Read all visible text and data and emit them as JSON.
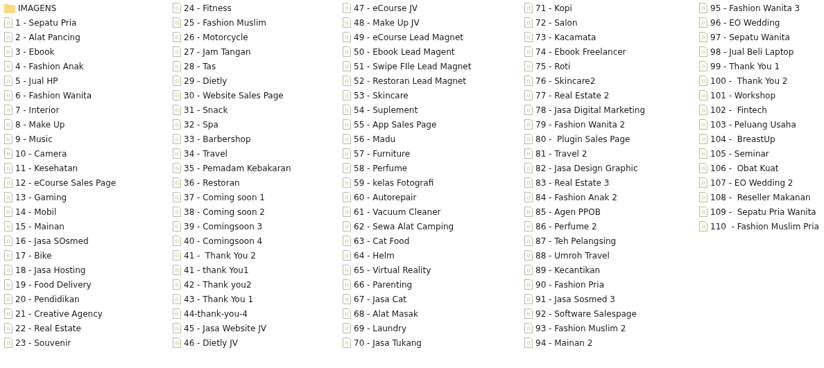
{
  "items": [
    {
      "kind": "folder",
      "name": "IMAGENS"
    },
    {
      "kind": "file",
      "name": "1 - Sepatu Pria"
    },
    {
      "kind": "file",
      "name": "2 - Alat Pancing"
    },
    {
      "kind": "file",
      "name": "3 - Ebook"
    },
    {
      "kind": "file",
      "name": "4 - Fashion Anak"
    },
    {
      "kind": "file",
      "name": "5 - Jual HP"
    },
    {
      "kind": "file",
      "name": "6 - Fashion Wanita"
    },
    {
      "kind": "file",
      "name": "7 - Interior"
    },
    {
      "kind": "file",
      "name": "8 - Make Up"
    },
    {
      "kind": "file",
      "name": "9 - Music"
    },
    {
      "kind": "file",
      "name": "10 - Camera"
    },
    {
      "kind": "file",
      "name": "11 - Kesehatan"
    },
    {
      "kind": "file",
      "name": "12 - eCourse Sales Page"
    },
    {
      "kind": "file",
      "name": "13 - Gaming"
    },
    {
      "kind": "file",
      "name": "14 - Mobil"
    },
    {
      "kind": "file",
      "name": "15 - Mainan"
    },
    {
      "kind": "file",
      "name": "16 - Jasa SOsmed"
    },
    {
      "kind": "file",
      "name": "17 - Bike"
    },
    {
      "kind": "file",
      "name": "18 - Jasa Hosting"
    },
    {
      "kind": "file",
      "name": "19 - Food Delivery"
    },
    {
      "kind": "file",
      "name": "20 - Pendidikan"
    },
    {
      "kind": "file",
      "name": "21 - Creative Agency"
    },
    {
      "kind": "file",
      "name": "22 - Real Estate"
    },
    {
      "kind": "file",
      "name": "23 - Souvenir"
    },
    {
      "kind": "file",
      "name": "24 - Fitness"
    },
    {
      "kind": "file",
      "name": "25 - Fashion Muslim"
    },
    {
      "kind": "file",
      "name": "26 - Motorcycle"
    },
    {
      "kind": "file",
      "name": "27 - Jam Tangan"
    },
    {
      "kind": "file",
      "name": "28 - Tas"
    },
    {
      "kind": "file",
      "name": "29 - Dietly"
    },
    {
      "kind": "file",
      "name": "30 - Website Sales Page"
    },
    {
      "kind": "file",
      "name": "31 - Snack"
    },
    {
      "kind": "file",
      "name": "32 - Spa"
    },
    {
      "kind": "file",
      "name": "33 - Barbershop"
    },
    {
      "kind": "file",
      "name": "34 - Travel"
    },
    {
      "kind": "file",
      "name": "35 - Pemadam Kebakaran"
    },
    {
      "kind": "file",
      "name": "36 - Restoran"
    },
    {
      "kind": "file",
      "name": "37 - Coming soon 1"
    },
    {
      "kind": "file",
      "name": "38 - Coming soon 2"
    },
    {
      "kind": "file",
      "name": "39 - Comingsoon 3"
    },
    {
      "kind": "file",
      "name": "40 - Comingsoon 4"
    },
    {
      "kind": "file",
      "name": "41 -  Thank You 2"
    },
    {
      "kind": "file",
      "name": "41 - thank You1"
    },
    {
      "kind": "file",
      "name": "42 - Thank you2"
    },
    {
      "kind": "file",
      "name": "43 - Thank You 1"
    },
    {
      "kind": "file",
      "name": "44-thank-you-4"
    },
    {
      "kind": "file",
      "name": "45 - Jasa Website JV"
    },
    {
      "kind": "file",
      "name": "46 - Dietly JV"
    },
    {
      "kind": "file",
      "name": "47 - eCourse JV"
    },
    {
      "kind": "file",
      "name": "48 - Make Up JV"
    },
    {
      "kind": "file",
      "name": "49 - eCourse Lead Magnet"
    },
    {
      "kind": "file",
      "name": "50 - Ebook Lead Magent"
    },
    {
      "kind": "file",
      "name": "51 - Swipe FIle Lead Magnet"
    },
    {
      "kind": "file",
      "name": "52 - Restoran Lead Magnet"
    },
    {
      "kind": "file",
      "name": "53 - Skincare"
    },
    {
      "kind": "file",
      "name": "54 - Suplement"
    },
    {
      "kind": "file",
      "name": "55 - App Sales Page"
    },
    {
      "kind": "file",
      "name": "56 - Madu"
    },
    {
      "kind": "file",
      "name": "57 - Furniture"
    },
    {
      "kind": "file",
      "name": "58 - Perfume"
    },
    {
      "kind": "file",
      "name": "59 - kelas Fotografi"
    },
    {
      "kind": "file",
      "name": "60 - Autorepair"
    },
    {
      "kind": "file",
      "name": "61 - Vacuum Cleaner"
    },
    {
      "kind": "file",
      "name": "62 - Sewa Alat Camping"
    },
    {
      "kind": "file",
      "name": "63 - Cat Food"
    },
    {
      "kind": "file",
      "name": "64 - Helm"
    },
    {
      "kind": "file",
      "name": "65 - Virtual Reality"
    },
    {
      "kind": "file",
      "name": "66 - Parenting"
    },
    {
      "kind": "file",
      "name": "67 - Jasa Cat"
    },
    {
      "kind": "file",
      "name": "68 - Alat Masak"
    },
    {
      "kind": "file",
      "name": "69 - Laundry"
    },
    {
      "kind": "file",
      "name": "70 - Jasa Tukang"
    },
    {
      "kind": "file",
      "name": "71 - Kopi"
    },
    {
      "kind": "file",
      "name": "72 - Salon"
    },
    {
      "kind": "file",
      "name": "73 - Kacamata"
    },
    {
      "kind": "file",
      "name": "74 - Ebook Freelancer"
    },
    {
      "kind": "file",
      "name": "75 - Roti"
    },
    {
      "kind": "file",
      "name": "76 - Skincare2"
    },
    {
      "kind": "file",
      "name": "77 - Real Estate 2"
    },
    {
      "kind": "file",
      "name": "78 - Jasa Digital Marketing"
    },
    {
      "kind": "file",
      "name": "79 - Fashion Wanita 2"
    },
    {
      "kind": "file",
      "name": "80 -  Plugin Sales Page"
    },
    {
      "kind": "file",
      "name": "81 - Travel 2"
    },
    {
      "kind": "file",
      "name": "82 - Jasa Design Graphic"
    },
    {
      "kind": "file",
      "name": "83 - Real Estate 3"
    },
    {
      "kind": "file",
      "name": "84 - Fashion Anak 2"
    },
    {
      "kind": "file",
      "name": "85 - Agen PPOB"
    },
    {
      "kind": "file",
      "name": "86 - Perfume 2"
    },
    {
      "kind": "file",
      "name": "87 - Teh Pelangsing"
    },
    {
      "kind": "file",
      "name": "88 - Umroh Travel"
    },
    {
      "kind": "file",
      "name": "89 - Kecantikan"
    },
    {
      "kind": "file",
      "name": "90 - Fashion Pria"
    },
    {
      "kind": "file",
      "name": "91 - Jasa Sosmed 3"
    },
    {
      "kind": "file",
      "name": "92 - Software Salespage"
    },
    {
      "kind": "file",
      "name": "93 - Fashion Muslim 2"
    },
    {
      "kind": "file",
      "name": "94 - Mainan 2"
    },
    {
      "kind": "file",
      "name": "95 - Fashion Wanita 3"
    },
    {
      "kind": "file",
      "name": "96 - EO Wedding"
    },
    {
      "kind": "file",
      "name": "97 - Sepatu Wanita"
    },
    {
      "kind": "file",
      "name": "98 - Jual Beli Laptop"
    },
    {
      "kind": "file",
      "name": "99 - Thank You 1"
    },
    {
      "kind": "file",
      "name": "100 -  Thank You 2"
    },
    {
      "kind": "file",
      "name": "101 - Workshop"
    },
    {
      "kind": "file",
      "name": "102 -  Fintech"
    },
    {
      "kind": "file",
      "name": "103 - Peluang Usaha"
    },
    {
      "kind": "file",
      "name": "104 -  BreastUp"
    },
    {
      "kind": "file",
      "name": "105 - Seminar"
    },
    {
      "kind": "file",
      "name": "106 -  Obat Kuat"
    },
    {
      "kind": "file",
      "name": "107 - EO Wedding 2"
    },
    {
      "kind": "file",
      "name": "108 -  Reseller Makanan"
    },
    {
      "kind": "file",
      "name": "109 -  Sepatu Pria Wanita"
    },
    {
      "kind": "file",
      "name": "110  - Fashion Muslim Pria"
    }
  ]
}
